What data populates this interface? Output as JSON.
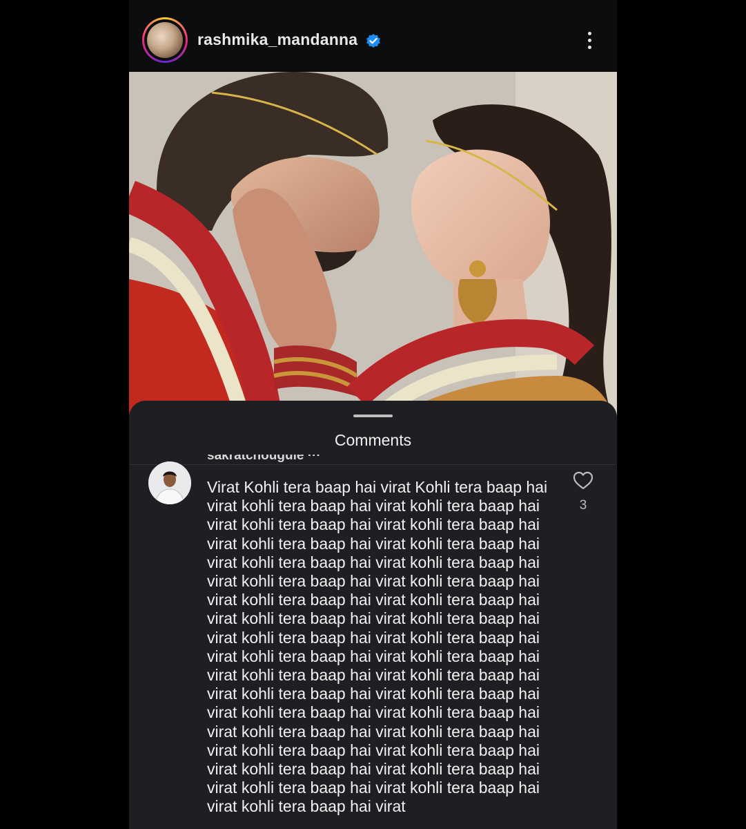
{
  "post": {
    "username": "rashmika_mandanna",
    "verified": true,
    "verified_badge_color": "#1f8ef1",
    "avatar_icon": "profile-avatar",
    "menu_icon": "more-vertical-icon"
  },
  "comments_sheet": {
    "title": "Comments",
    "background": "#1e1f22",
    "comment": {
      "username": "sakratchougule ···",
      "text": "Virat Kohli tera baap hai virat Kohli tera baap hai virat kohli tera baap hai virat kohli tera baap hai virat kohli tera baap hai virat kohli tera baap hai virat kohli tera baap hai virat kohli tera baap hai virat kohli tera baap hai virat kohli tera baap hai virat kohli tera baap hai virat kohli tera baap hai virat kohli tera baap hai virat kohli tera baap hai virat kohli tera baap hai virat kohli tera baap hai virat kohli tera baap hai virat kohli tera baap hai virat kohli tera baap hai virat kohli tera baap hai virat kohli tera baap hai virat kohli tera baap hai virat kohli tera baap hai virat kohli tera baap hai virat kohli tera baap hai virat kohli tera baap hai virat kohli tera baap hai virat kohli tera baap hai virat kohli tera baap hai virat kohli tera baap hai virat kohli tera baap hai virat kohli tera baap hai virat kohli tera baap hai virat kohli tera baap hai virat kohli tera baap hai virat",
      "like_icon": "heart-icon",
      "like_count": "3"
    }
  }
}
